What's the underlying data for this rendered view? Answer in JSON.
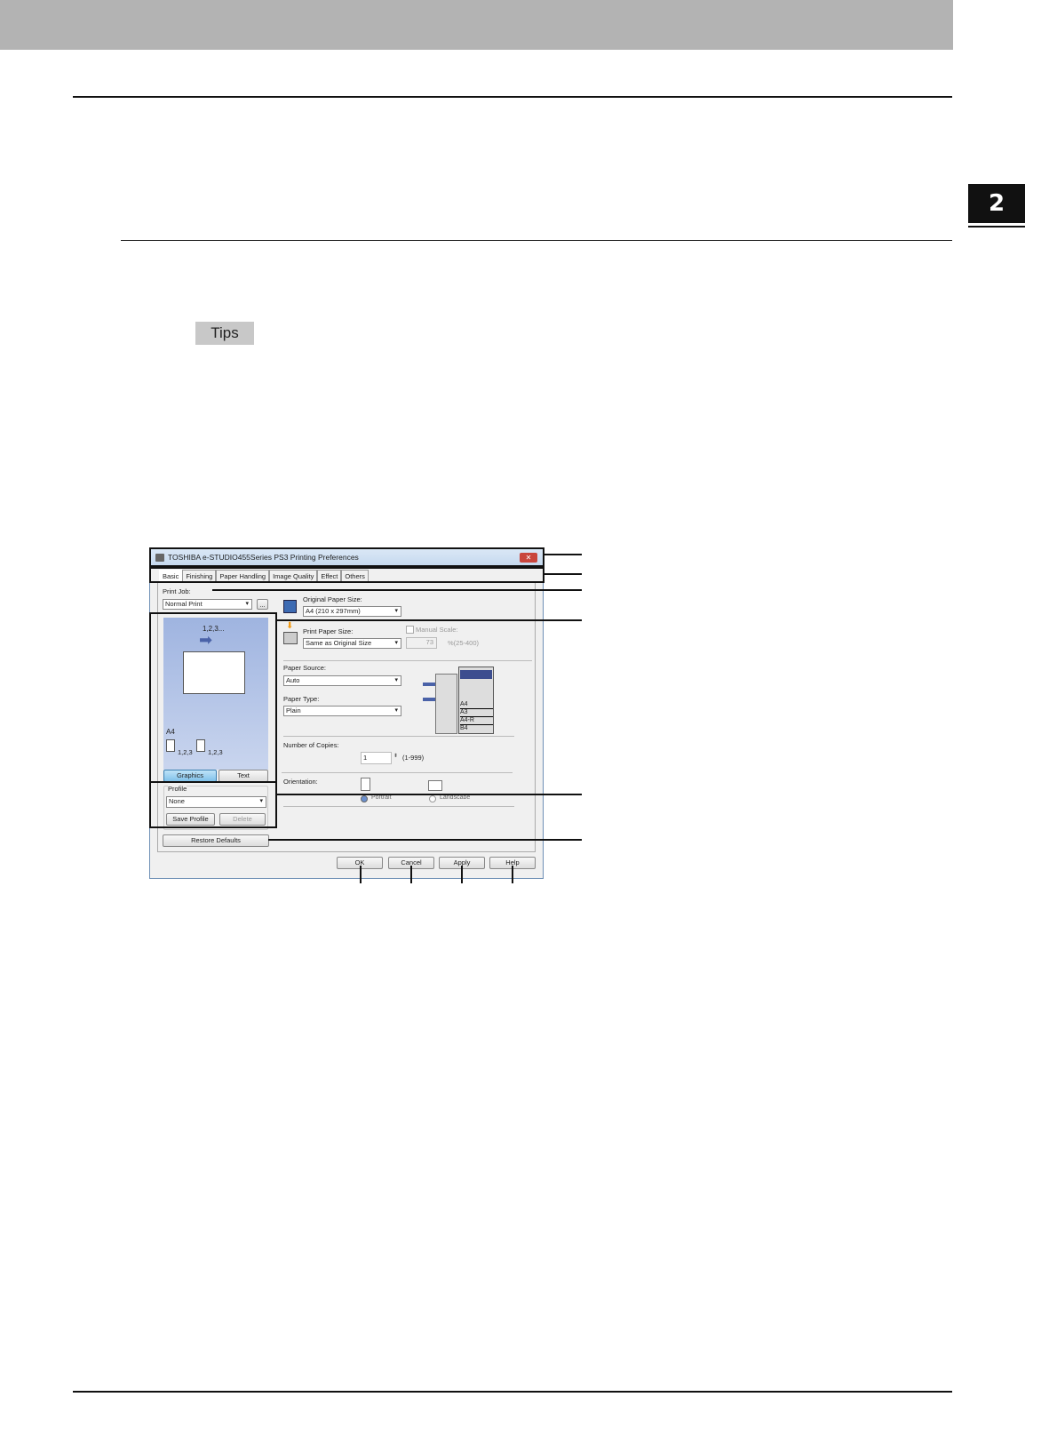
{
  "chapter_number": "2",
  "tips_label": "Tips",
  "dialog": {
    "title": "TOSHIBA e-STUDIO455Series PS3 Printing Preferences",
    "close": "✕",
    "tabs": [
      "Basic",
      "Finishing",
      "Paper Handling",
      "Image Quality",
      "Effect",
      "Others"
    ],
    "print_job_label": "Print Job:",
    "print_job_value": "Normal Print",
    "more_button": "...",
    "original_paper_size_label": "Original Paper Size:",
    "original_paper_size_value": "A4 (210 x 297mm)",
    "print_paper_size_label": "Print Paper Size:",
    "print_paper_size_value": "Same as Original Size",
    "manual_scale_label": "Manual Scale:",
    "manual_scale_value": "73",
    "manual_scale_range": "%(25-400)",
    "paper_source_label": "Paper Source:",
    "paper_source_value": "Auto",
    "paper_type_label": "Paper Type:",
    "paper_type_value": "Plain",
    "trays": [
      "A4",
      "A3",
      "A4-R",
      "B4"
    ],
    "copies_label": "Number of Copies:",
    "copies_value": "1",
    "copies_range": "(1-999)",
    "orientation_label": "Orientation:",
    "orientation_options": [
      "Portrait",
      "Landscape"
    ],
    "preview_order": "1,2,3...",
    "preview_paper": "A4",
    "preview_collate": [
      "1,2,3",
      "1,2,3"
    ],
    "view_buttons": [
      "Graphics",
      "Text"
    ],
    "profile_label": "Profile",
    "profile_value": "None",
    "save_profile": "Save Profile",
    "delete": "Delete",
    "restore_defaults": "Restore Defaults",
    "buttons": {
      "ok": "OK",
      "cancel": "Cancel",
      "apply": "Apply",
      "help": "Help"
    }
  }
}
